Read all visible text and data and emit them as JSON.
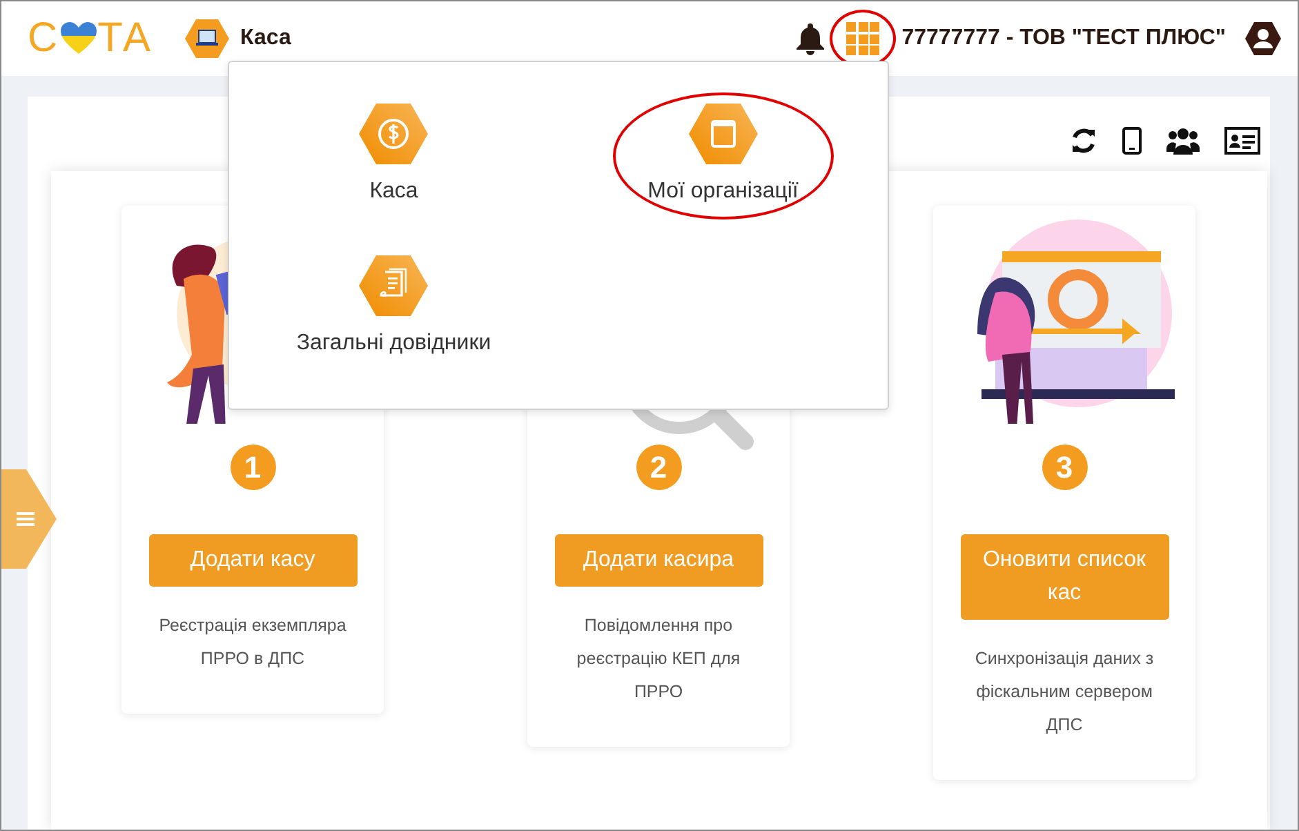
{
  "header": {
    "logo": {
      "left": "С",
      "right": "ТА"
    },
    "module": {
      "label": "Каса"
    },
    "apps_button": {
      "highlighted": true
    },
    "organization": "77777777 - ТОВ \"ТЕСТ ПЛЮС\""
  },
  "app_menu": {
    "items": [
      {
        "label": "Каса",
        "kind": "dollar",
        "highlighted": false
      },
      {
        "label": "Мої організації",
        "kind": "window",
        "highlighted": true
      },
      {
        "label": "Загальні довідники",
        "kind": "document",
        "highlighted": false
      }
    ]
  },
  "steps": [
    {
      "number": "1",
      "button": "Додати касу",
      "description": "Реєстрація екземпляра ПРРО в ДПС",
      "kind": "woman-tablet"
    },
    {
      "number": "2",
      "button": "Додати касира",
      "description": "Повідомлення про реєстрацію КЕП для ПРРО",
      "kind": "magnifier"
    },
    {
      "number": "3",
      "button": "Оновити список кас",
      "description": "Синхронізація даних з фіскальним сервером ДПС",
      "kind": "woman-screen"
    }
  ]
}
